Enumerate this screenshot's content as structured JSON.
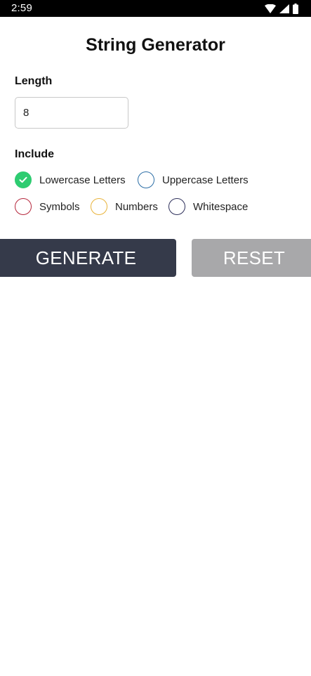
{
  "status_bar": {
    "time": "2:59",
    "icons": [
      "wifi-icon",
      "signal-icon",
      "battery-icon"
    ]
  },
  "app": {
    "title": "String Generator"
  },
  "length": {
    "label": "Length",
    "value": "8"
  },
  "include": {
    "label": "Include",
    "options": [
      {
        "label": "Lowercase Letters",
        "checked": true,
        "color": "#2ecc71"
      },
      {
        "label": "Uppercase Letters",
        "checked": false,
        "color": "#2c6ea6"
      },
      {
        "label": "Symbols",
        "checked": false,
        "color": "#b5263b"
      },
      {
        "label": "Numbers",
        "checked": false,
        "color": "#e8b33a"
      },
      {
        "label": "Whitespace",
        "checked": false,
        "color": "#2d2f5a"
      }
    ]
  },
  "buttons": {
    "generate_label": "GENERATE",
    "generate_color": "#353a4a",
    "reset_label": "RESET",
    "reset_color": "#a8a8aa"
  }
}
